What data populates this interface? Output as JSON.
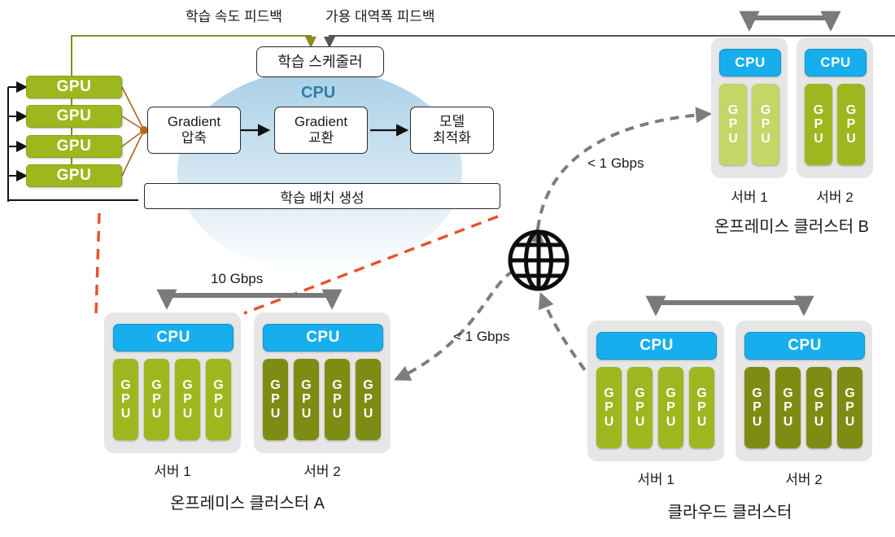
{
  "detail_panel": {
    "gpu_label": "GPU",
    "gpu_count": 4,
    "feedback_left": "학습 속도 피드백",
    "feedback_right": "가용 대역폭 피드백",
    "scheduler": "학습 스케줄러",
    "cpu_dome_label": "CPU",
    "pipeline": [
      {
        "line1": "Gradient",
        "line2": "압축"
      },
      {
        "line1": "Gradient",
        "line2": "교환"
      },
      {
        "line1": "모델",
        "line2": "최적화"
      }
    ],
    "batch_box": "학습 배치 생성"
  },
  "clusters": [
    {
      "id": "on-premise-a",
      "title": "온프레미스 클러스터 A",
      "interconnect_label": "10 Gbps",
      "servers": [
        {
          "name": "서버 1",
          "cpu_label": "CPU",
          "gpu_label": "GPU",
          "gpu_count": 4,
          "gpu_color": "#9CB81E"
        },
        {
          "name": "서버 2",
          "cpu_label": "CPU",
          "gpu_label": "GPU",
          "gpu_count": 4,
          "gpu_color": "#7E8C14"
        }
      ]
    },
    {
      "id": "on-premise-b",
      "title": "온프레미스 클러스터 B",
      "interconnect_label": "",
      "servers": [
        {
          "name": "서버 1",
          "cpu_label": "CPU",
          "gpu_label": "GPU",
          "gpu_count": 2,
          "gpu_color": "#C3D666"
        },
        {
          "name": "서버 2",
          "cpu_label": "CPU",
          "gpu_label": "GPU",
          "gpu_count": 2,
          "gpu_color": "#9CB81E"
        }
      ]
    },
    {
      "id": "cloud",
      "title": "클라우드 클러스터",
      "interconnect_label": "",
      "servers": [
        {
          "name": "서버 1",
          "cpu_label": "CPU",
          "gpu_label": "GPU",
          "gpu_count": 4,
          "gpu_color": "#9CB81E"
        },
        {
          "name": "서버 2",
          "cpu_label": "CPU",
          "gpu_label": "GPU",
          "gpu_count": 4,
          "gpu_color": "#7E8C14"
        }
      ]
    }
  ],
  "network": {
    "hub_icon": "globe-icon",
    "link_to_b": "< 1 Gbps",
    "link_to_a": "< 1 Gbps"
  },
  "colors": {
    "gpu_green": "#9CB81E",
    "gpu_green_dark": "#7E8C14",
    "gpu_green_light": "#C3D666",
    "cpu_blue": "#17AEEE",
    "dome_blue": "#BBD9EC",
    "callout_orange": "#E8502A",
    "link_gray": "#808080",
    "feedback_olive": "#8A8A1E"
  }
}
